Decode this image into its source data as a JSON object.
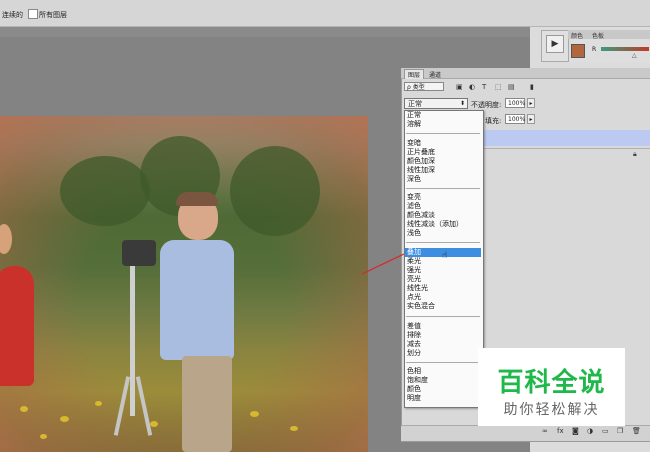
{
  "options_bar": {
    "contiguous_label": "连续的",
    "all_layers_label": "所有图层"
  },
  "color_panel": {
    "tabs": [
      "颜色",
      "色板"
    ],
    "channel_label": "R",
    "foreground_color": "#b0673d"
  },
  "layers_panel": {
    "tabs": [
      "图层",
      "通道"
    ],
    "filter_label": "ρ 类型",
    "blend_mode_value": "正常",
    "opacity_label": "不透明度:",
    "opacity_value": "100%",
    "fill_label": "填充:",
    "fill_value": "100%"
  },
  "blend_modes": {
    "group1": [
      "正常",
      "溶解"
    ],
    "group2": [
      "变暗",
      "正片叠底",
      "颜色加深",
      "线性加深",
      "深色"
    ],
    "group3": [
      "变亮",
      "滤色",
      "颜色减淡",
      "线性减淡（添加）",
      "浅色"
    ],
    "group4": [
      "叠加",
      "柔光",
      "强光",
      "亮光",
      "线性光",
      "点光",
      "实色混合"
    ],
    "group5": [
      "差值",
      "排除",
      "减去",
      "划分"
    ],
    "group6": [
      "色相",
      "饱和度",
      "颜色",
      "明度"
    ],
    "selected": "叠加"
  },
  "watermark": {
    "title": "百科全说",
    "subtitle": "助你轻松解决"
  },
  "colors": {
    "accent_selected": "#3e8ee0",
    "watermark_green": "#1fb84a"
  }
}
